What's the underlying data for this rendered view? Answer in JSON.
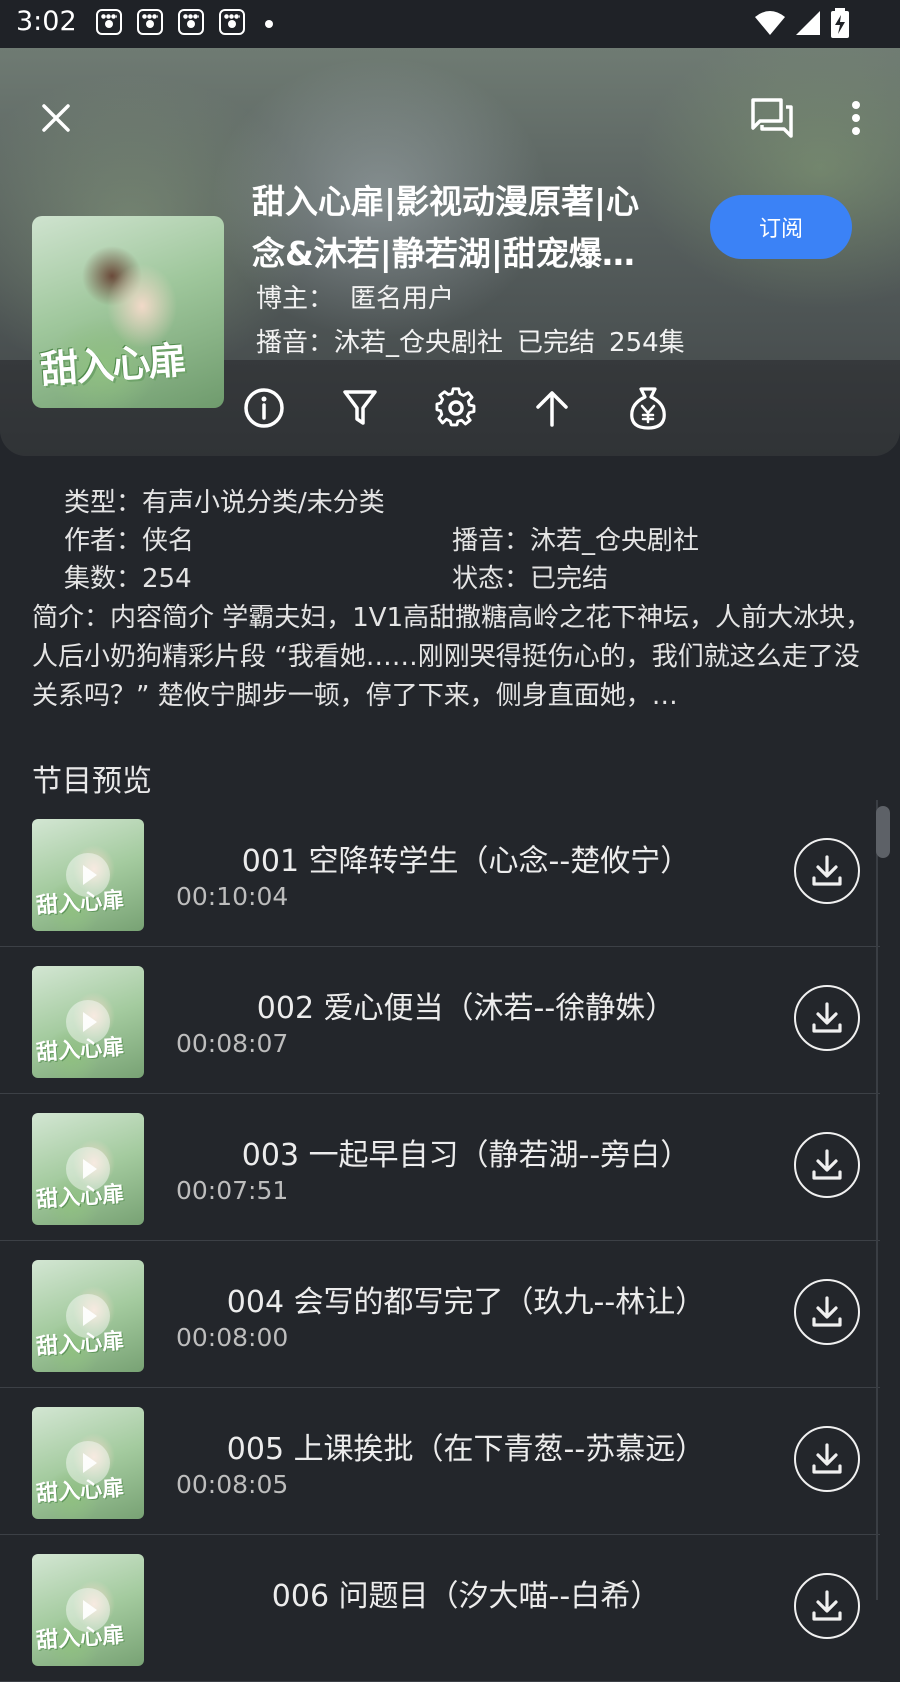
{
  "status_bar": {
    "time": "3:02",
    "notification_icons": [
      "baidu-paw-icon",
      "baidu-paw-icon",
      "baidu-paw-icon",
      "baidu-paw-icon"
    ],
    "system_icons": [
      "wifi-icon",
      "signal-icon",
      "battery-charging-icon"
    ]
  },
  "header": {
    "icons": [
      "close-icon",
      "comment-icon",
      "more-vertical-icon"
    ],
    "cover_text": "甜入心扉",
    "title": "甜入心扉|影视动漫原著|心念&沐若|静若湖|甜宠爆…",
    "subscribe_label": "订阅",
    "blogger_label": "博主：",
    "blogger_name": "匿名用户",
    "narrator_label": "播音：沐若_仓央剧社",
    "status": "已完结",
    "episode_count": "254集",
    "action_icons": [
      "info-icon",
      "filter-icon",
      "settings-icon",
      "top-icon",
      "money-bag-icon"
    ]
  },
  "details": {
    "type": "类型：有声小说分类/未分类",
    "author": "作者：侠名",
    "narrator": "播音：沐若_仓央剧社",
    "episodes": "集数：254",
    "state": "状态：已完结",
    "intro": "简介：内容简介 学霸夫妇，1V1高甜撒糖高岭之花下神坛，人前大冰块，人后小奶狗精彩片段 “我看她……刚刚哭得挺伤心的，我们就这么走了没关系吗？” 楚攸宁脚步一顿，停了下来，侧身直面她，…",
    "section_title": "节目预览"
  },
  "episodes": [
    {
      "title": "001 空降转学生（心念--楚攸宁）",
      "duration": "00:10:04"
    },
    {
      "title": "002 爱心便当（沐若--徐静姝）",
      "duration": "00:08:07"
    },
    {
      "title": "003 一起早自习（静若湖--旁白）",
      "duration": "00:07:51"
    },
    {
      "title": "004 会写的都写完了（玖九--林让）",
      "duration": "00:08:00"
    },
    {
      "title": "005 上课挨批（在下青葱--苏慕远）",
      "duration": "00:08:05"
    },
    {
      "title": "006 问题目（汐大喵--白希）",
      "duration": ""
    }
  ],
  "colors": {
    "background": "#23262b",
    "accent": "#3b82f6"
  }
}
